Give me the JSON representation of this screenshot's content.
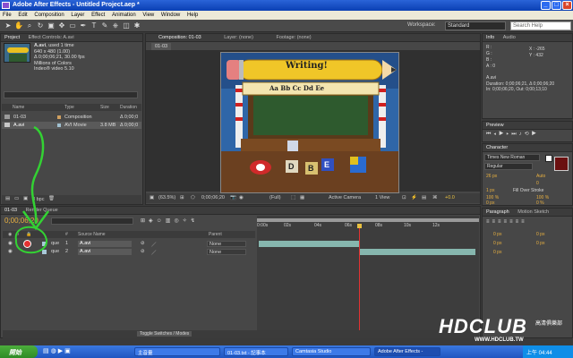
{
  "window": {
    "title": "Adobe After Effects - Untitled Project.aep *"
  },
  "menu": [
    "File",
    "Edit",
    "Composition",
    "Layer",
    "Effect",
    "Animation",
    "View",
    "Window",
    "Help"
  ],
  "workspace": {
    "label": "Workspace:",
    "value": "Standard",
    "search_placeholder": "Search Help"
  },
  "project": {
    "tabs": [
      "Project",
      "Effect Controls: A.avi"
    ],
    "item_name": "A.avi",
    "item_used": ", used 1 time",
    "size": "640 x 480 (1.00)",
    "duration": "Δ 0;00;06;21, 30.00 fps",
    "colors": "Millions of Colors",
    "codec": "Indeo® video 5.10",
    "columns": [
      "Name",
      "Type",
      "Size",
      "Duration"
    ],
    "rows": [
      {
        "name": "01-03",
        "type": "Composition",
        "size": "",
        "duration": "Δ 0;00;0"
      },
      {
        "name": "A.avi",
        "type": "AVI Movie",
        "size": "3.8 MB",
        "duration": "Δ 0;00;0"
      }
    ],
    "bpc": "8 bpc"
  },
  "composition": {
    "tabs": [
      "Composition: 01-03",
      "Layer: (none)",
      "Footage: (none)"
    ],
    "comp_tab": "01-03",
    "writing": "Writing!",
    "alphabet": "Aa Bb Cc Dd Ee",
    "blocks": [
      "D",
      "B",
      "E"
    ],
    "zoom": "(63.5%)",
    "timecode": "0;00;06;20",
    "resolution": "(Full)",
    "camera": "Active Camera",
    "view": "1 View",
    "exposure": "+0.0"
  },
  "info": {
    "tabs": [
      "Info",
      "Audio"
    ],
    "r": "R :",
    "g": "G :",
    "b": "B :",
    "a": "A : 0",
    "x": "X : -265",
    "y": "Y : 432",
    "file": "A.avi",
    "duration": "Duration: 0;00;06;21, Δ 0;00;06;20",
    "in_out": "In: 0;00;06;20, Out: 0;00;13;10"
  },
  "preview": {
    "tab": "Preview"
  },
  "character": {
    "tab": "Character",
    "font": "Times New Roman",
    "style": "Regular",
    "size": "26 px",
    "leading": "Auto",
    "tracking": "0",
    "stroke": "1 px",
    "stroke_type": "Fill Over Stroke",
    "scale_v": "100 %",
    "scale_h": "100 %",
    "baseline": "0 px",
    "tsume": "0 %"
  },
  "timeline": {
    "tabs": [
      "01-03",
      "Render Queue"
    ],
    "timecode": "0;00;06;20",
    "columns": [
      "#",
      "Source Name",
      "Parent"
    ],
    "layers": [
      {
        "index": "1",
        "name": "A.avi",
        "parent": "None",
        "mode": "que"
      },
      {
        "index": "2",
        "name": "A.avi",
        "parent": "None",
        "mode": "que"
      }
    ],
    "ruler": [
      "0:00s",
      "02s",
      "04s",
      "06s",
      "08s",
      "10s",
      "12s"
    ],
    "toggle": "Toggle Switches / Modes"
  },
  "paragraph": {
    "tabs": [
      "Paragraph",
      "Motion Sketch"
    ],
    "values": [
      "0 px",
      "0 px",
      "0 px",
      "0 px",
      "0 px"
    ]
  },
  "taskbar": {
    "start": "開始",
    "tasks": [
      "主音量",
      "01-03.txt - 記事本",
      "Camtasia Studio",
      "Adobe After Effects -"
    ],
    "tray": "上午 04:44"
  },
  "watermark": {
    "big": "HDCLUB",
    "url": "WWW.HDCLUB.TW",
    "cn": "高清俱樂部"
  },
  "colors": {
    "accent": "#2a64d8",
    "annotation": "#33d233",
    "playhead": "#e23232"
  }
}
